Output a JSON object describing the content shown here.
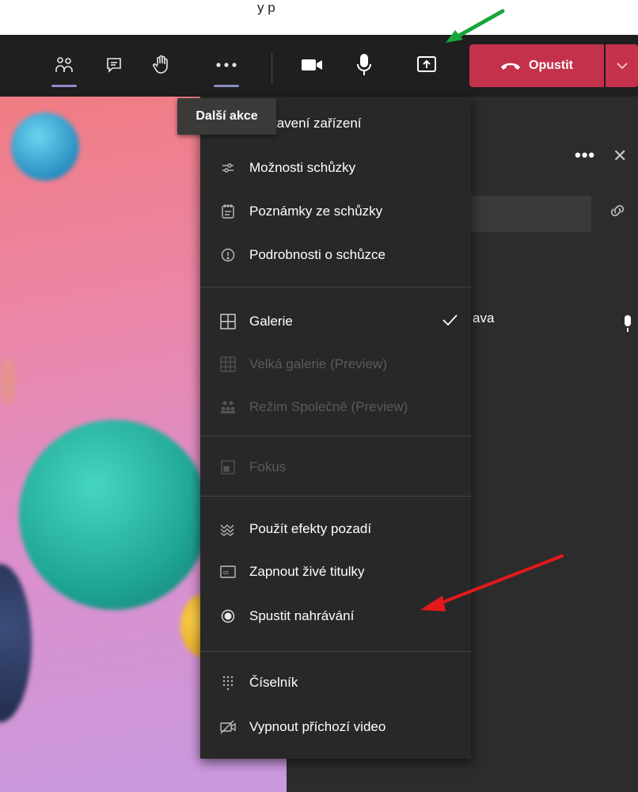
{
  "top_text": "y                          p",
  "toolbar": {
    "leave_label": "Opustit",
    "icons": [
      "participants-icon",
      "chat-icon",
      "raise-hand-icon",
      "more-actions-icon",
      "camera-icon",
      "microphone-icon",
      "share-screen-icon",
      "phone-hangup-icon",
      "chevron-down-icon"
    ]
  },
  "tooltip": "Další akce",
  "menu": {
    "items": [
      {
        "label": "tavení zařízení",
        "icon": "device-settings-icon"
      },
      {
        "label": "Možnosti schůzky",
        "icon": "meeting-options-icon"
      },
      {
        "label": "Poznámky ze schůzky",
        "icon": "meeting-notes-icon"
      },
      {
        "label": "Podrobnosti o schůzce",
        "icon": "info-icon"
      },
      {
        "label": "Galerie",
        "icon": "gallery-icon",
        "checked": true
      },
      {
        "label": "Velká galerie (Preview)",
        "icon": "large-gallery-icon",
        "disabled": true
      },
      {
        "label": "Režim Společně (Preview)",
        "icon": "together-mode-icon",
        "disabled": true
      },
      {
        "label": "Fokus",
        "icon": "focus-icon",
        "disabled": true
      },
      {
        "label": "Použít efekty pozadí",
        "icon": "background-effects-icon"
      },
      {
        "label": "Zapnout živé titulky",
        "icon": "captions-icon"
      },
      {
        "label": "Spustit nahrávání",
        "icon": "record-icon"
      },
      {
        "label": "Číselník",
        "icon": "dial-pad-icon"
      },
      {
        "label": "Vypnout příchozí video",
        "icon": "video-off-icon"
      }
    ]
  },
  "right_panel": {
    "participant_name": "ava"
  },
  "colors": {
    "toolbar_bg": "#1f1f1f",
    "menu_bg": "#292828",
    "leave_red": "#c4314b",
    "accent": "#8b8cc7",
    "annotation_green": "#1aa53a",
    "annotation_red": "#e3191b"
  }
}
